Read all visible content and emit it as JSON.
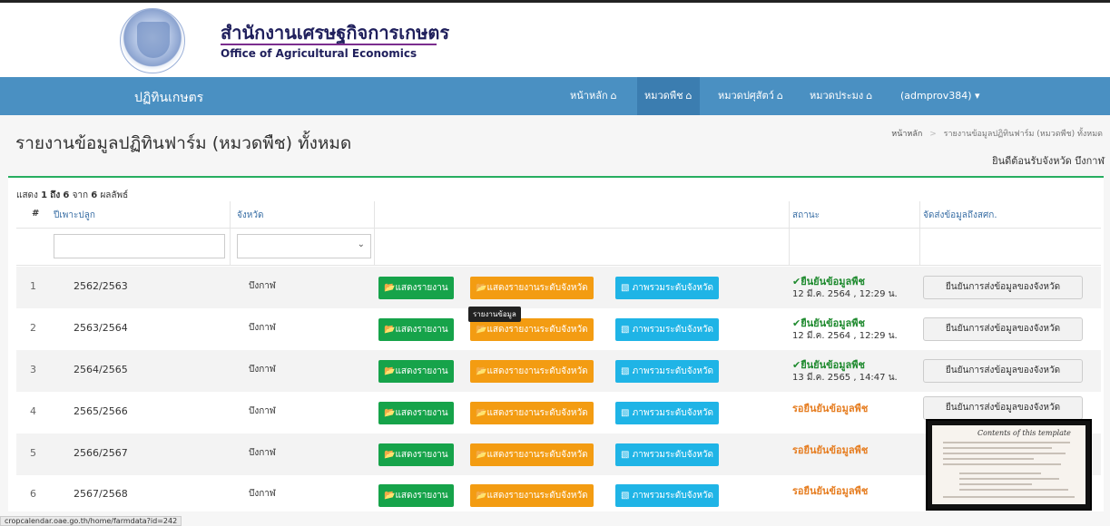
{
  "header": {
    "org_th": "สำนักงานเศรษฐกิจการเกษตร",
    "org_en": "Office of Agricultural Economics"
  },
  "navbar": {
    "brand": "ปฏิทินเกษตร",
    "items": [
      {
        "label": "หน้าหลัก",
        "icon": "home-icon"
      },
      {
        "label": "หมวดพืช",
        "icon": "home-icon",
        "active": true
      },
      {
        "label": "หมวดปศุสัตว์",
        "icon": "home-icon"
      },
      {
        "label": "หมวดประมง",
        "icon": "home-icon"
      }
    ],
    "user": "(admprov384)",
    "user_caret": "▾"
  },
  "page": {
    "title": "รายงานข้อมูลปฏิทินฟาร์ม (หมวดพืช) ทั้งหมด",
    "breadcrumb_home": "หน้าหลัก",
    "breadcrumb_sep": ">",
    "breadcrumb_current": "รายงานข้อมูลปฏิทินฟาร์ม (หมวดพืช) ทั้งหมด",
    "welcome": "ยินดีต้อนรับจังหวัด บึงกาฬ"
  },
  "table": {
    "count_prefix": "แสดง",
    "count_from": "1",
    "count_to_word": "ถึง",
    "count_to": "6",
    "count_of_word": "จาก",
    "count_total": "6",
    "count_suffix": "ผลลัพธ์",
    "headers": {
      "num": "#",
      "year": "ปีเพาะปลูก",
      "province": "จังหวัด",
      "status": "สถานะ",
      "send": "จัดส่งข้อมูลถึงสศก."
    },
    "buttons": {
      "report": "แสดงรายงาน",
      "province_report": "แสดงรายงานระดับจังหวัด",
      "overview": "ภาพรวมระดับจังหวัด",
      "confirm_send": "ยืนยันการส่งข้อมูลของจังหวัด"
    },
    "tooltip": "รายงานข้อมูล",
    "rows": [
      {
        "num": "1",
        "year": "2562/2563",
        "province": "บึงกาฬ",
        "status": "✔ยืนยันข้อมูลพืช",
        "status_date": "12 มี.ค. 2564 , 12:29 น.",
        "confirmed": true
      },
      {
        "num": "2",
        "year": "2563/2564",
        "province": "บึงกาฬ",
        "status": "✔ยืนยันข้อมูลพืช",
        "status_date": "12 มี.ค. 2564 , 12:29 น.",
        "confirmed": true
      },
      {
        "num": "3",
        "year": "2564/2565",
        "province": "บึงกาฬ",
        "status": "✔ยืนยันข้อมูลพืช",
        "status_date": "13 มี.ค. 2565 , 14:47 น.",
        "confirmed": true
      },
      {
        "num": "4",
        "year": "2565/2566",
        "province": "บึงกาฬ",
        "status": "รอยืนยันข้อมูลพืช",
        "status_date": "",
        "confirmed": false
      },
      {
        "num": "5",
        "year": "2566/2567",
        "province": "บึงกาฬ",
        "status": "รอยืนยันข้อมูลพืช",
        "status_date": "",
        "confirmed": false
      },
      {
        "num": "6",
        "year": "2567/2568",
        "province": "บึงกาฬ",
        "status": "รอยืนยันข้อมูลพืช",
        "status_date": "",
        "confirmed": false
      }
    ]
  },
  "overlay": {
    "thumbnail_title": "Contents of this template"
  },
  "statusbar": {
    "url": "cropcalendar.oae.go.th/home/farmdata?id=242"
  },
  "colors": {
    "navbar": "#4a90c2",
    "green_button": "#16a34a",
    "orange_button": "#f39c12",
    "blue_button": "#1fb4e6",
    "confirmed": "#1e8a2e",
    "pending": "#e67e22"
  }
}
